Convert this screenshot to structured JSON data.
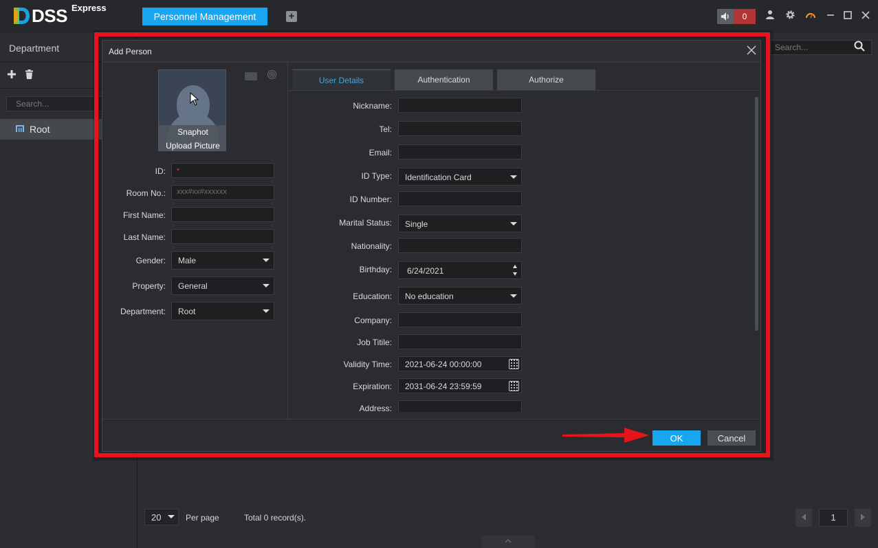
{
  "app": {
    "brand": "DSS",
    "brand_sub": "Express",
    "active_tab": "Personnel Management",
    "alarm_count": "0"
  },
  "sidebar": {
    "title": "Department",
    "search_placeholder": "Search...",
    "tree": [
      {
        "label": "Root"
      }
    ]
  },
  "main": {
    "search_placeholder": "Search...",
    "per_page_value": "20",
    "per_page_label": "Per page",
    "total_label": "Total 0 record(s).",
    "page_number": "1"
  },
  "dialog": {
    "title": "Add Person",
    "photo": {
      "snapshot_label": "Snaphot",
      "upload_label": "Upload Picture"
    },
    "left_form": {
      "id_label": "ID:",
      "room_label": "Room No.:",
      "room_placeholder": "xxx#xx#xxxxxx",
      "first_name_label": "First Name:",
      "last_name_label": "Last Name:",
      "gender_label": "Gender:",
      "gender_value": "Male",
      "property_label": "Property:",
      "property_value": "General",
      "department_label": "Department:",
      "department_value": "Root"
    },
    "tabs": [
      "User Details",
      "Authentication",
      "Authorize"
    ],
    "user_details": {
      "nickname_label": "Nickname:",
      "tel_label": "Tel:",
      "email_label": "Email:",
      "id_type_label": "ID Type:",
      "id_type_value": "Identification Card",
      "id_number_label": "ID Number:",
      "marital_label": "Marital Status:",
      "marital_value": "Single",
      "nationality_label": "Nationality:",
      "birthday_label": "Birthday:",
      "birthday_value": "6/24/2021",
      "education_label": "Education:",
      "education_value": "No education",
      "company_label": "Company:",
      "job_title_label": "Job Titile:",
      "validity_label": "Validity Time:",
      "validity_value": "2021-06-24 00:00:00",
      "expiration_label": "Expiration:",
      "expiration_value": "2031-06-24 23:59:59",
      "address_label": "Address:"
    },
    "ok_label": "OK",
    "cancel_label": "Cancel"
  },
  "colors": {
    "accent": "#18a6f0",
    "annotation": "#e8141b",
    "alarm": "#b23535"
  }
}
